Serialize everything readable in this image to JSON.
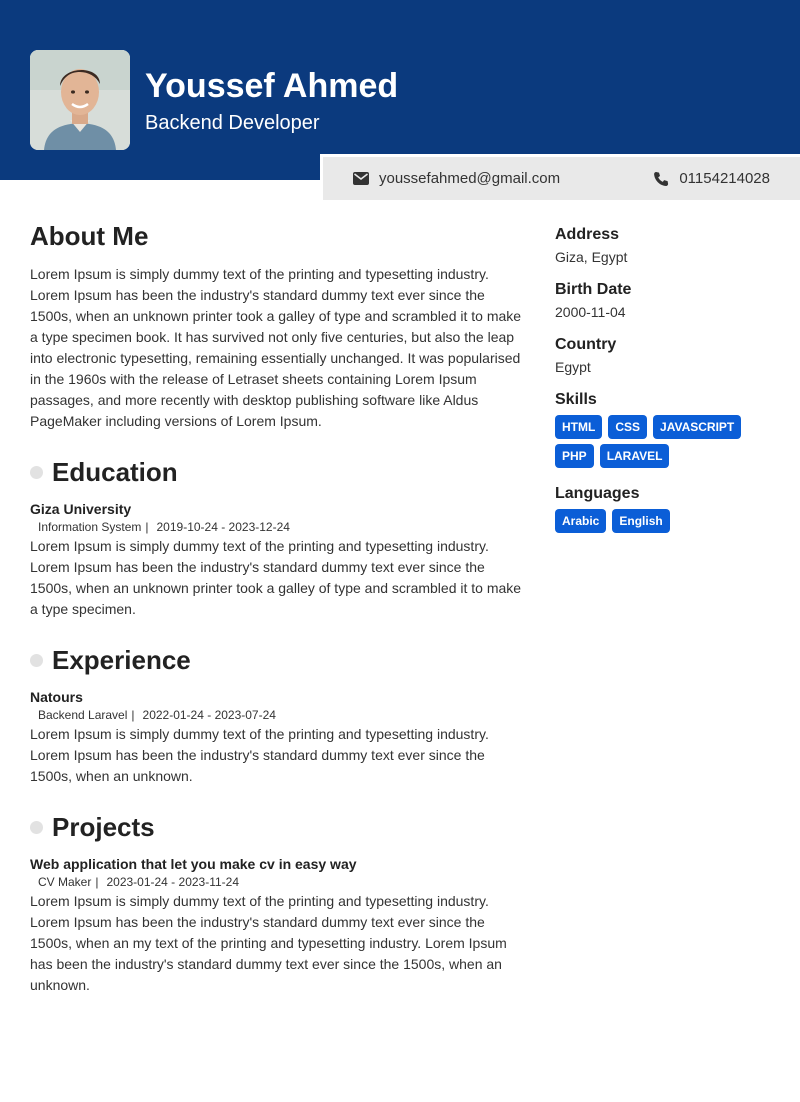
{
  "profile": {
    "name": "Youssef Ahmed",
    "role": "Backend Developer",
    "email": "youssefahmed@gmail.com",
    "phone": "01154214028"
  },
  "about": {
    "title": "About Me",
    "text": "Lorem Ipsum is simply dummy text of the printing and typesetting industry. Lorem Ipsum has been the industry's standard dummy text ever since the 1500s, when an unknown printer took a galley of type and scrambled it to make a type specimen book. It has survived not only five centuries, but also the leap into electronic typesetting, remaining essentially unchanged. It was popularised in the 1960s with the release of Letraset sheets containing Lorem Ipsum passages, and more recently with desktop publishing software like Aldus PageMaker including versions of Lorem Ipsum."
  },
  "education": {
    "title": "Education",
    "entry": {
      "name": "Giza University",
      "sub": "Information System",
      "dates": "2019-10-24 - 2023-12-24",
      "text": "Lorem Ipsum is simply dummy text of the printing and typesetting industry. Lorem Ipsum has been the industry's standard dummy text ever since the 1500s, when an unknown printer took a galley of type and scrambled it to make a type specimen."
    }
  },
  "experience": {
    "title": "Experience",
    "entry": {
      "name": "Natours",
      "sub": "Backend Laravel",
      "dates": "2022-01-24 - 2023-07-24",
      "text": "Lorem Ipsum is simply dummy text of the printing and typesetting industry. Lorem Ipsum has been the industry's standard dummy text ever since the 1500s, when an unknown."
    }
  },
  "projects": {
    "title": "Projects",
    "entry": {
      "name": "Web application that let you make cv in easy way",
      "sub": "CV Maker",
      "dates": "2023-01-24 - 2023-11-24",
      "text": "Lorem Ipsum is simply dummy text of the printing and typesetting industry. Lorem Ipsum has been the industry's standard dummy text ever since the 1500s, when an my text of the printing and typesetting industry. Lorem Ipsum has been the industry's standard dummy text ever since the 1500s, when an unknown."
    }
  },
  "sidebar": {
    "address_label": "Address",
    "address": "Giza, Egypt",
    "birth_label": "Birth Date",
    "birth": "2000-11-04",
    "country_label": "Country",
    "country": "Egypt",
    "skills_label": "Skills",
    "skills": [
      "HTML",
      "CSS",
      "JAVASCRIPT",
      "PHP",
      "LARAVEL"
    ],
    "languages_label": "Languages",
    "languages": [
      "Arabic",
      "English"
    ]
  },
  "colors": {
    "header": "#0b3a7e",
    "tag": "#0b5ed7",
    "contact_bar": "#e9e9e9"
  },
  "icons": {
    "email": "envelope-icon",
    "phone": "phone-icon"
  }
}
